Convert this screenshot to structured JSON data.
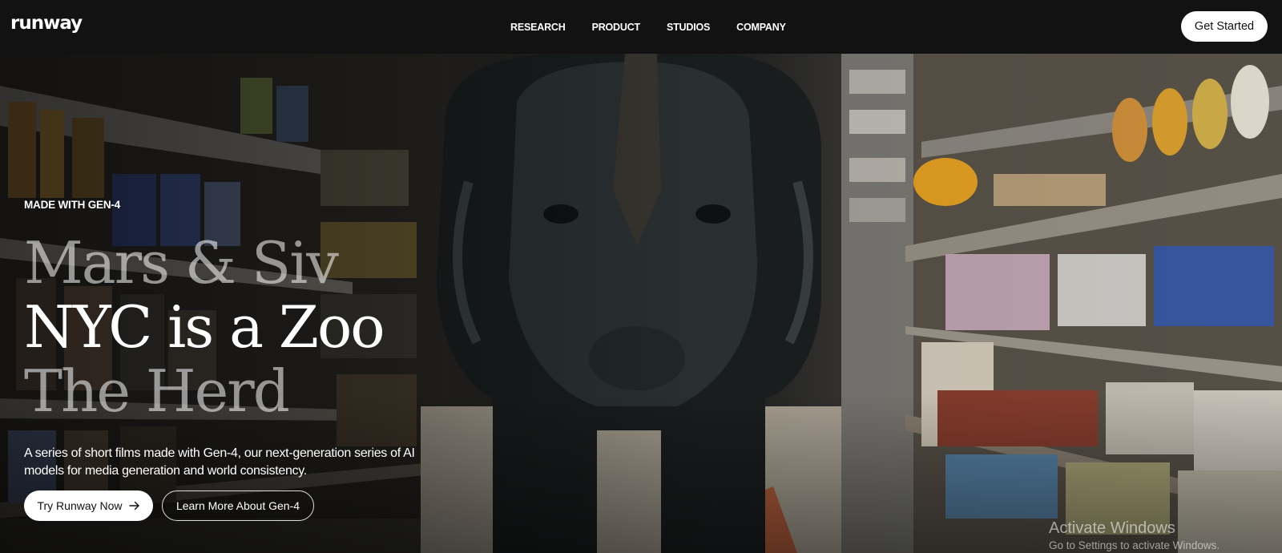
{
  "brand": {
    "logo_text": "runway"
  },
  "nav": {
    "items": [
      {
        "label": "RESEARCH"
      },
      {
        "label": "PRODUCT"
      },
      {
        "label": "STUDIOS"
      },
      {
        "label": "COMPANY"
      }
    ],
    "cta_label": "Get Started"
  },
  "hero": {
    "eyebrow": "MADE WITH GEN-4",
    "films": [
      {
        "title": "Mars & Siv",
        "active": false
      },
      {
        "title": "NYC is a Zoo",
        "active": true
      },
      {
        "title": "The Herd",
        "active": false
      }
    ],
    "description": "A series of short films made with Gen-4, our next-generation series of AI models for media generation and world consistency.",
    "primary_cta": "Try Runway Now",
    "primary_cta_icon": "arrow-right-icon",
    "secondary_cta": "Learn More About Gen-4",
    "background_subject": "rhino-in-grocery-aisle"
  },
  "os_watermark": {
    "title": "Activate Windows",
    "subtitle": "Go to Settings to activate Windows."
  },
  "colors": {
    "nav_bg": "#121212",
    "button_bg": "#ffffff",
    "button_text": "#111111"
  }
}
